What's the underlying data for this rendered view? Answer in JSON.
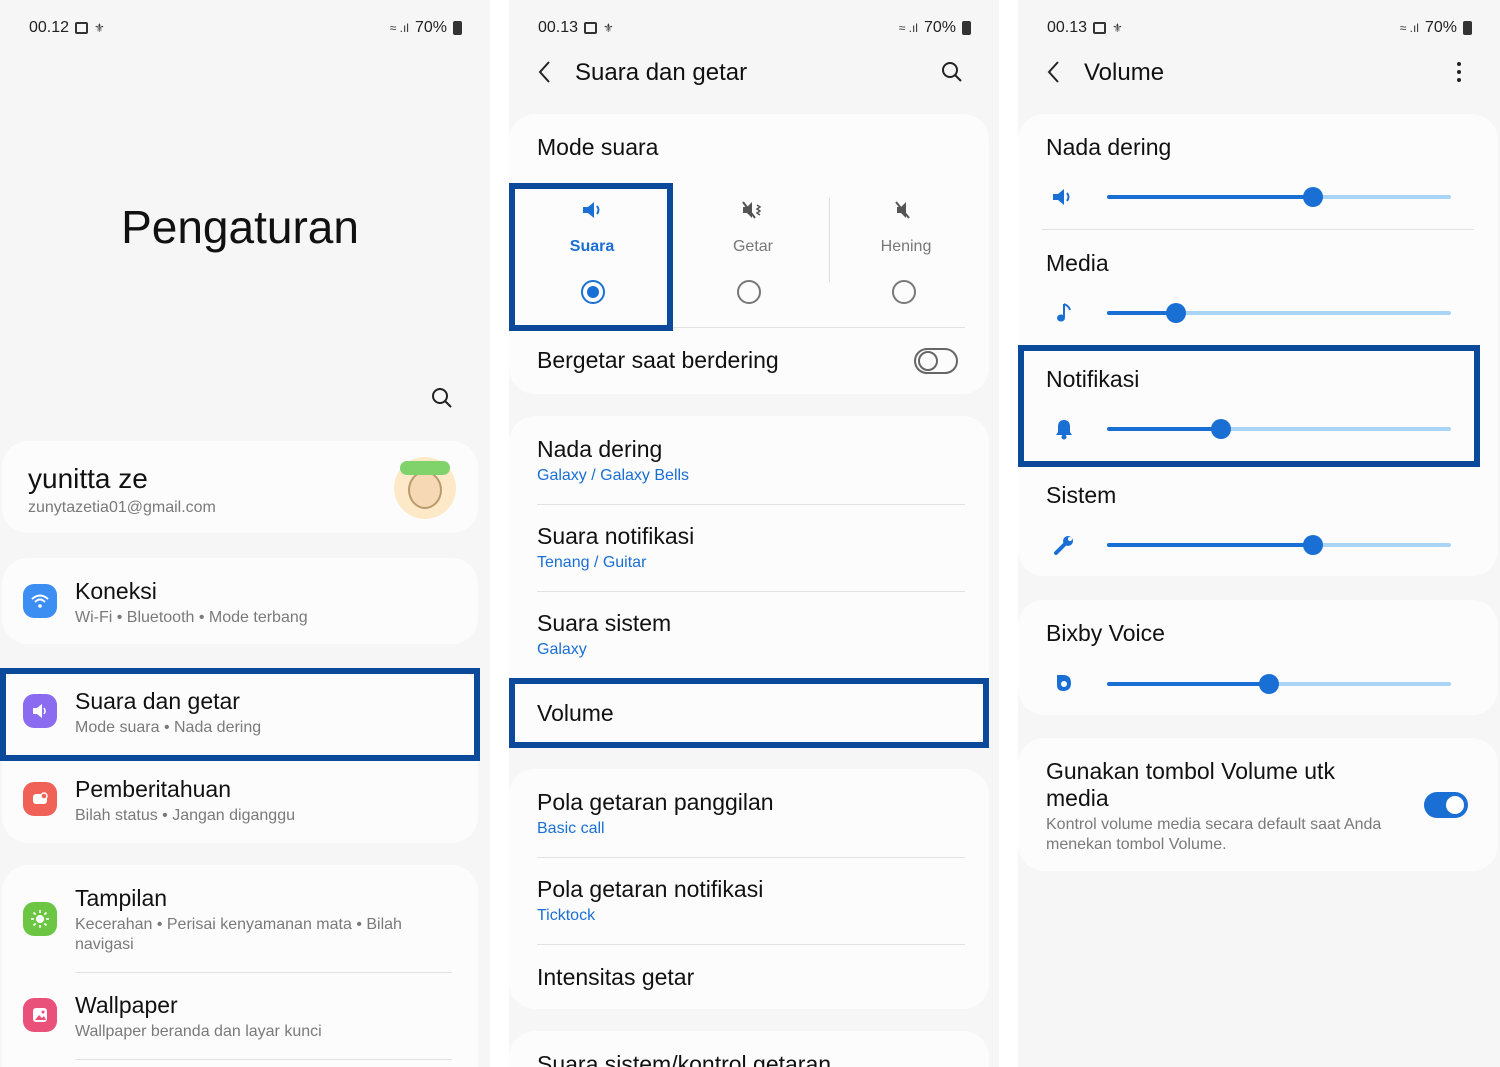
{
  "panels": [
    {
      "status": {
        "time": "00.12",
        "battery": "70%"
      },
      "title": "Pengaturan",
      "account": {
        "name": "yunitta ze",
        "email": "zunytazetia01@gmail.com"
      },
      "items": [
        {
          "title": "Koneksi",
          "subtitle": "Wi-Fi  •  Bluetooth  •  Mode terbang",
          "color": "#3d8ef2"
        },
        {
          "title": "Suara dan getar",
          "subtitle": "Mode suara  •  Nada dering",
          "color": "#8b6cf0"
        },
        {
          "title": "Pemberitahuan",
          "subtitle": "Bilah status  •  Jangan diganggu",
          "color": "#f06158"
        },
        {
          "title": "Tampilan",
          "subtitle": "Kecerahan  •  Perisai kenyamanan mata  •  Bilah",
          "subtitle2": "navigasi",
          "color": "#6cc644"
        },
        {
          "title": "Wallpaper",
          "subtitle": "Wallpaper beranda dan layar kunci",
          "color": "#e9517a"
        }
      ]
    },
    {
      "status": {
        "time": "00.13",
        "battery": "70%"
      },
      "title": "Suara dan getar",
      "mode_header": "Mode suara",
      "modes": [
        {
          "label": "Suara",
          "selected": true
        },
        {
          "label": "Getar",
          "selected": false
        },
        {
          "label": "Hening",
          "selected": false
        }
      ],
      "vibrate_label": "Bergetar saat berdering",
      "items": [
        {
          "title": "Nada dering",
          "subtitle": "Galaxy / Galaxy Bells"
        },
        {
          "title": "Suara notifikasi",
          "subtitle": "Tenang / Guitar"
        },
        {
          "title": "Suara sistem",
          "subtitle": "Galaxy"
        },
        {
          "title": "Volume"
        },
        {
          "title": "Pola getaran panggilan",
          "subtitle": "Basic call"
        },
        {
          "title": "Pola getaran notifikasi",
          "subtitle": "Ticktock"
        },
        {
          "title": "Intensitas getar"
        },
        {
          "title": "Suara sistem/kontrol getaran"
        }
      ]
    },
    {
      "status": {
        "time": "00.13",
        "battery": "70%"
      },
      "title": "Volume",
      "sliders": [
        {
          "label": "Nada dering",
          "value": 0.6,
          "icon": "speaker-icon"
        },
        {
          "label": "Media",
          "value": 0.2,
          "icon": "music-note-icon"
        },
        {
          "label": "Notifikasi",
          "value": 0.33,
          "icon": "bell-icon"
        },
        {
          "label": "Sistem",
          "value": 0.6,
          "icon": "wrench-icon"
        },
        {
          "label": "Bixby Voice",
          "value": 0.47,
          "icon": "bixby-icon"
        }
      ],
      "media_toggle": {
        "title_line1": "Gunakan tombol Volume utk",
        "title_line2": "media",
        "desc_line1": "Kontrol volume media secara default saat Anda",
        "desc_line2": "menekan tombol Volume.",
        "on": true
      }
    }
  ]
}
